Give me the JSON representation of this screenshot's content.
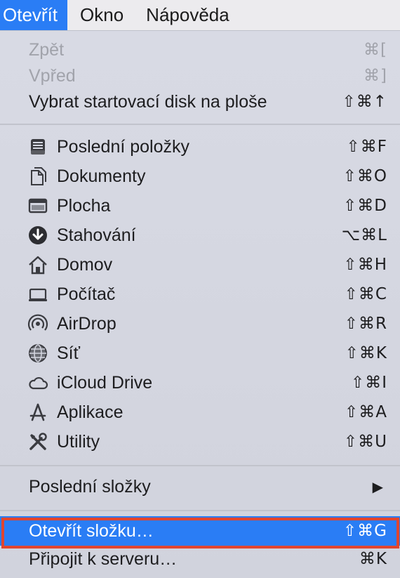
{
  "menubar": {
    "items": [
      {
        "label": "Otevřít"
      },
      {
        "label": "Okno"
      },
      {
        "label": "Nápověda"
      }
    ]
  },
  "menu": {
    "top": [
      {
        "label": "Zpět",
        "shortcut": "⌘[",
        "enabled": false
      },
      {
        "label": "Vpřed",
        "shortcut": "⌘]",
        "enabled": false
      },
      {
        "label": "Vybrat startovací disk na ploše",
        "shortcut": "⇧⌘↑",
        "enabled": true
      }
    ],
    "places": [
      {
        "label": "Poslední položky",
        "shortcut": "⇧⌘F",
        "icon": "recents-icon"
      },
      {
        "label": "Dokumenty",
        "shortcut": "⇧⌘O",
        "icon": "documents-icon"
      },
      {
        "label": "Plocha",
        "shortcut": "⇧⌘D",
        "icon": "desktop-icon"
      },
      {
        "label": "Stahování",
        "shortcut": "⌥⌘L",
        "icon": "downloads-icon"
      },
      {
        "label": "Domov",
        "shortcut": "⇧⌘H",
        "icon": "home-icon"
      },
      {
        "label": "Počítač",
        "shortcut": "⇧⌘C",
        "icon": "computer-icon"
      },
      {
        "label": "AirDrop",
        "shortcut": "⇧⌘R",
        "icon": "airdrop-icon"
      },
      {
        "label": "Síť",
        "shortcut": "⇧⌘K",
        "icon": "network-icon"
      },
      {
        "label": "iCloud Drive",
        "shortcut": "⇧⌘I",
        "icon": "icloud-icon"
      },
      {
        "label": "Aplikace",
        "shortcut": "⇧⌘A",
        "icon": "applications-icon"
      },
      {
        "label": "Utility",
        "shortcut": "⇧⌘U",
        "icon": "utilities-icon"
      }
    ],
    "recent_folders": {
      "label": "Poslední složky",
      "submenu_glyph": "▶"
    },
    "bottom": [
      {
        "label": "Otevřít složku…",
        "shortcut": "⇧⌘G",
        "highlighted": true
      },
      {
        "label": "Připojit k serveru…",
        "shortcut": "⌘K",
        "highlighted": false
      }
    ]
  },
  "colors": {
    "highlight": "#2a7df5",
    "annotation_frame": "#e0452f",
    "menu_background": "#d6d8e2"
  }
}
